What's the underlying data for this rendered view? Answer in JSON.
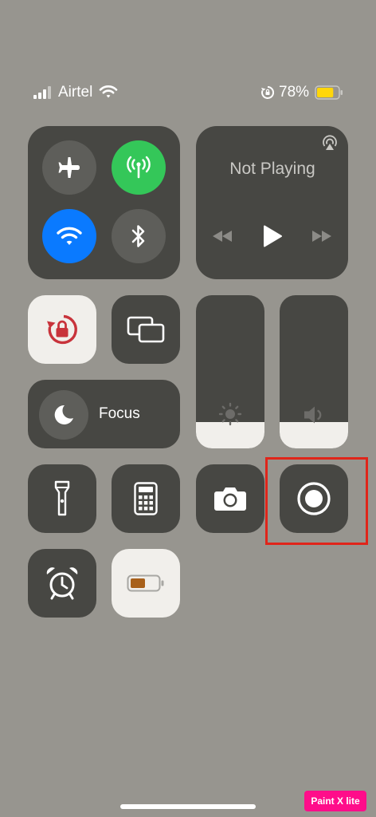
{
  "status_bar": {
    "carrier": "Airtel",
    "battery_percent": "78%",
    "battery_level": 0.78,
    "icons": [
      "signal-bars-icon",
      "wifi-icon",
      "orientation-lock-icon",
      "battery-icon"
    ]
  },
  "connectivity": {
    "airplane_mode": false,
    "cellular_data": true,
    "wifi": true,
    "bluetooth": false
  },
  "now_playing": {
    "title": "Not Playing",
    "controls": [
      "rewind-icon",
      "play-icon",
      "fast-forward-icon"
    ]
  },
  "focus": {
    "label": "Focus"
  },
  "brightness_level": 0.17,
  "volume_level": 0.17,
  "tiles": [
    "orientation-lock",
    "screen-mirroring",
    "flashlight",
    "calculator",
    "camera",
    "screen-recording",
    "alarm",
    "low-power-mode"
  ],
  "colors": {
    "background": "#97958f",
    "tile": "#474743",
    "active_green": "#34c759",
    "active_blue": "#0a7aff",
    "highlight_red": "#e0251a",
    "lock_red": "#c8333b"
  },
  "watermark": "Paint X lite"
}
